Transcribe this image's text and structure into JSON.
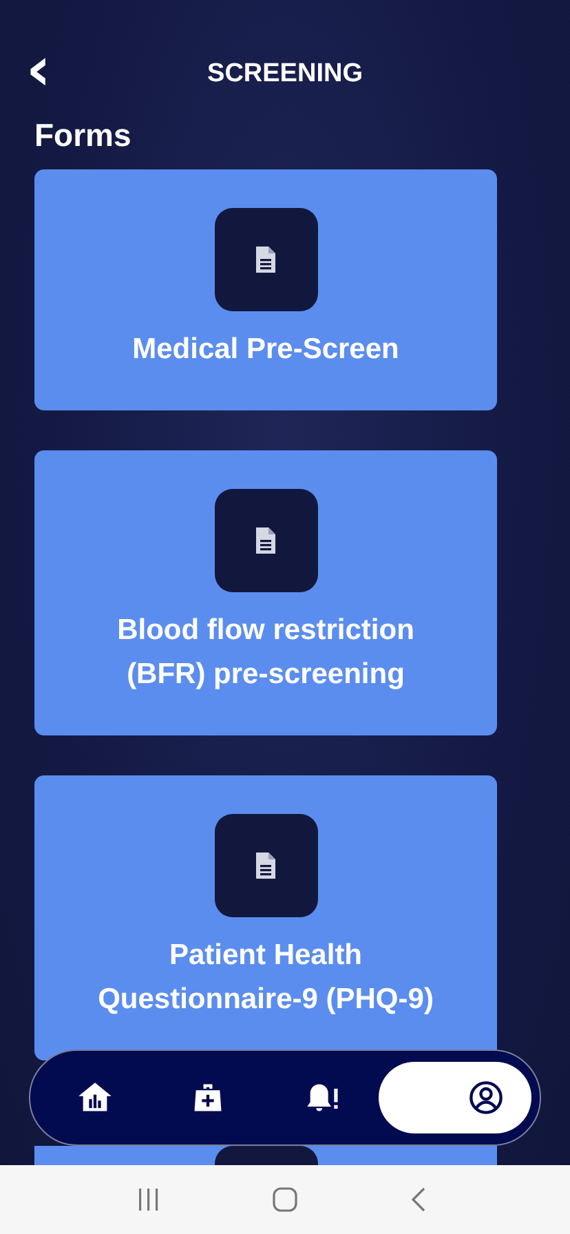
{
  "header": {
    "back_icon": "‹",
    "title": "SCREENING"
  },
  "section_title": "Forms",
  "forms": [
    {
      "kind": "form",
      "title": "Medical Pre-Screen"
    },
    {
      "kind": "form",
      "title": "Blood flow restriction (BFR) pre-screening"
    },
    {
      "kind": "form",
      "title": "Patient Health Questionnaire-9 (PHQ-9)"
    },
    {
      "kind": "partial"
    }
  ],
  "bottom_nav": [
    {
      "kind": "home",
      "selected": false
    },
    {
      "kind": "medical",
      "selected": false
    },
    {
      "kind": "alerts",
      "selected": false
    },
    {
      "kind": "profile",
      "selected": true
    }
  ],
  "system_nav": [
    {
      "kind": "recents"
    },
    {
      "kind": "home"
    },
    {
      "kind": "back"
    }
  ]
}
